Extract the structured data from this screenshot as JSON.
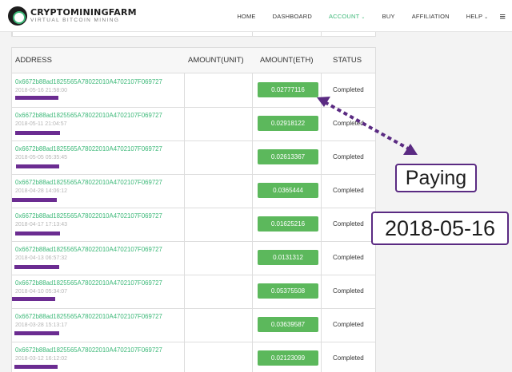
{
  "brand": {
    "title": "CRYPTOMININGFARM",
    "subtitle": "VIRTUAL BITCOIN MINING"
  },
  "nav": {
    "home": "HOME",
    "dashboard": "DASHBOARD",
    "account": "ACCOUNT",
    "buy": "BUY",
    "affiliation": "AFFILIATION",
    "help": "HELP"
  },
  "table": {
    "headers": {
      "address": "ADDRESS",
      "amount_unit": "AMOUNT(UNIT)",
      "amount_eth": "AMOUNT(ETH)",
      "status": "STATUS"
    },
    "rows": [
      {
        "address": "0x6672b88ad1825565A78022010A4702107F069727",
        "date": "2018-05-16 21:58:00",
        "amount_eth": "0.02777116",
        "status": "Completed"
      },
      {
        "address": "0x6672b88ad1825565A78022010A4702107F069727",
        "date": "2018-05-11 21:04:57",
        "amount_eth": "0.02918122",
        "status": "Completed"
      },
      {
        "address": "0x6672b88ad1825565A78022010A4702107F069727",
        "date": "2018-05-05 05:35:45",
        "amount_eth": "0.02613367",
        "status": "Completed"
      },
      {
        "address": "0x6672b88ad1825565A78022010A4702107F069727",
        "date": "2018-04-28 14:06:12",
        "amount_eth": "0.0365444",
        "status": "Completed"
      },
      {
        "address": "0x6672b88ad1825565A78022010A4702107F069727",
        "date": "2018-04-17 17:13:43",
        "amount_eth": "0.01625216",
        "status": "Completed"
      },
      {
        "address": "0x6672b88ad1825565A78022010A4702107F069727",
        "date": "2018-04-13 06:57:32",
        "amount_eth": "0.0131312",
        "status": "Completed"
      },
      {
        "address": "0x6672b88ad1825565A78022010A4702107F069727",
        "date": "2018-04-10 05:34:07",
        "amount_eth": "0.05375508",
        "status": "Completed"
      },
      {
        "address": "0x6672b88ad1825565A78022010A4702107F069727",
        "date": "2018-03-28 15:13:17",
        "amount_eth": "0.03639587",
        "status": "Completed"
      },
      {
        "address": "0x6672b88ad1825565A78022010A4702107F069727",
        "date": "2018-03-12 16:12:02",
        "amount_eth": "0.02123099",
        "status": "Completed"
      }
    ]
  },
  "annotations": {
    "paying": "Paying",
    "date": "2018-05-16"
  },
  "colors": {
    "accent": "#3cb878",
    "amount_button": "#5cb85c",
    "redaction": "#6b2c91",
    "callout_border": "#5a2a82"
  }
}
